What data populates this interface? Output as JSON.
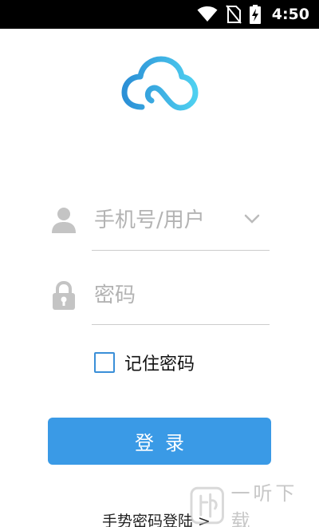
{
  "status_bar": {
    "time": "4:50",
    "icons": [
      "wifi-icon",
      "no-sim-icon",
      "battery-charging-icon"
    ]
  },
  "app": {
    "logo_icon": "cloud-logo-icon"
  },
  "login_form": {
    "username": {
      "icon": "user-icon",
      "placeholder": "手机号/用户",
      "value": "",
      "dropdown_icon": "chevron-down-icon"
    },
    "password": {
      "icon": "lock-icon",
      "placeholder": "密码",
      "value": ""
    },
    "remember_password": {
      "label": "记住密码",
      "checked": false
    },
    "login_button_label": "登录",
    "gesture_login_link": "手势密码登陆 >"
  },
  "watermark": {
    "text": "一听下载"
  },
  "colors": {
    "status_bar_bg": "#000000",
    "accent": "#3a9ae6",
    "checkbox_border": "#3a8fd8",
    "icon_gray": "#c4c4c4",
    "underline": "#cccccc",
    "logo_gradient_start": "#2b8fd6",
    "logo_gradient_end": "#4fd0f0"
  }
}
